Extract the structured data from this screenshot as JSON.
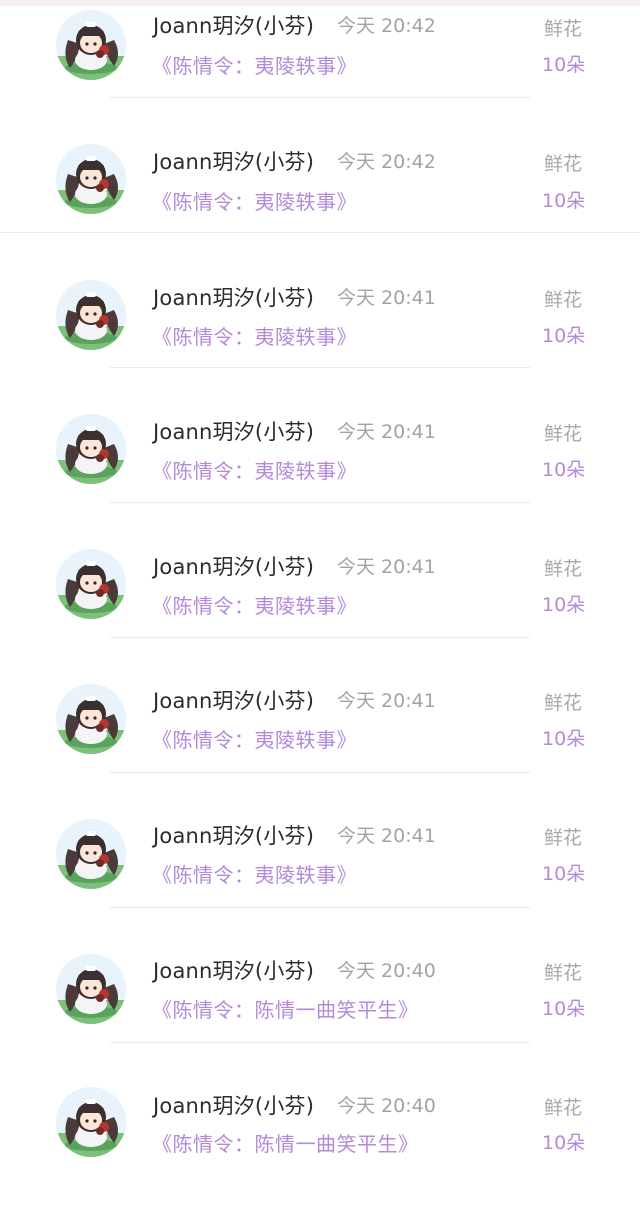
{
  "rows": [
    {
      "user": "Joann玥汐(小芬)",
      "time": "今天 20:42",
      "work": "《陈情令：夷陵轶事》",
      "gift": "鲜花",
      "count": "10朵"
    },
    {
      "user": "Joann玥汐(小芬)",
      "time": "今天 20:42",
      "work": "《陈情令：夷陵轶事》",
      "gift": "鲜花",
      "count": "10朵"
    },
    {
      "user": "Joann玥汐(小芬)",
      "time": "今天 20:41",
      "work": "《陈情令：夷陵轶事》",
      "gift": "鲜花",
      "count": "10朵"
    },
    {
      "user": "Joann玥汐(小芬)",
      "time": "今天 20:41",
      "work": "《陈情令：夷陵轶事》",
      "gift": "鲜花",
      "count": "10朵"
    },
    {
      "user": "Joann玥汐(小芬)",
      "time": "今天 20:41",
      "work": "《陈情令：夷陵轶事》",
      "gift": "鲜花",
      "count": "10朵"
    },
    {
      "user": "Joann玥汐(小芬)",
      "time": "今天 20:41",
      "work": "《陈情令：夷陵轶事》",
      "gift": "鲜花",
      "count": "10朵"
    },
    {
      "user": "Joann玥汐(小芬)",
      "time": "今天 20:41",
      "work": "《陈情令：夷陵轶事》",
      "gift": "鲜花",
      "count": "10朵"
    },
    {
      "user": "Joann玥汐(小芬)",
      "time": "今天 20:40",
      "work": "《陈情令：陈情一曲笑平生》",
      "gift": "鲜花",
      "count": "10朵"
    },
    {
      "user": "Joann玥汐(小芬)",
      "time": "今天 20:40",
      "work": "《陈情令：陈情一曲笑平生》",
      "gift": "鲜花",
      "count": "10朵"
    }
  ],
  "colors": {
    "accent_purple": "#b48ad8",
    "name_text": "#2b2b2b",
    "meta_text": "#a3a3a3",
    "divider": "#ececec"
  },
  "icons": {
    "avatar": "chibi-character-avatar-icon"
  }
}
